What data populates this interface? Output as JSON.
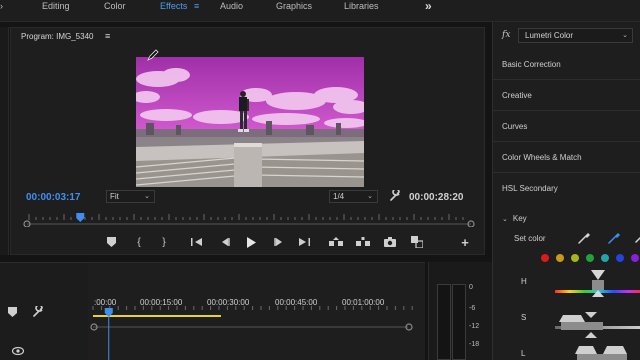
{
  "workspace": {
    "tabs": [
      {
        "label": "Editing",
        "active": false
      },
      {
        "label": "Color",
        "active": false
      },
      {
        "label": "Effects",
        "active": true
      },
      {
        "label": "Audio",
        "active": false
      },
      {
        "label": "Graphics",
        "active": false
      },
      {
        "label": "Libraries",
        "active": false
      }
    ],
    "more_icon": "double-chevron-right-icon"
  },
  "monitor": {
    "title": "Program: IMG_5340",
    "current_timecode": "00:00:03:17",
    "zoom_value": "Fit",
    "resolution_value": "1/4",
    "duration_timecode": "00:00:28:20",
    "playhead_fraction": 0.12
  },
  "transport": {
    "buttons": [
      "add-marker-icon",
      "mark-in-icon",
      "mark-out-icon",
      "go-to-in-icon",
      "step-back-icon",
      "play-icon",
      "step-forward-icon",
      "go-to-out-icon",
      "lift-icon",
      "extract-icon",
      "export-frame-icon",
      "comparison-view-icon",
      "add-button-icon"
    ]
  },
  "lumetri": {
    "effect_name": "Lumetri Color",
    "sections": [
      "Basic Correction",
      "Creative",
      "Curves",
      "Color Wheels & Match",
      "HSL Secondary"
    ],
    "key_label": "Key",
    "set_color_label": "Set color",
    "swatch_colors": [
      "#d81b1b",
      "#c99a1a",
      "#a4b61c",
      "#1fa33a",
      "#20a6a6",
      "#2146d8",
      "#8a1fd8",
      "#cfcfcf"
    ],
    "hsl_labels": [
      "H",
      "S",
      "L"
    ]
  },
  "timeline": {
    "ruler_labels": [
      ":00:00",
      "00:00:15:00",
      "00:00:30:00",
      "00:00:45:00",
      "00:01:00:00"
    ],
    "playhead_fraction": 0.05
  },
  "meters": {
    "db_labels": [
      "0",
      "-6",
      "-12",
      "-18"
    ]
  },
  "colors": {
    "accent": "#3f8ff0",
    "background": "#1e1e1e",
    "sky": "#b53cb5"
  }
}
